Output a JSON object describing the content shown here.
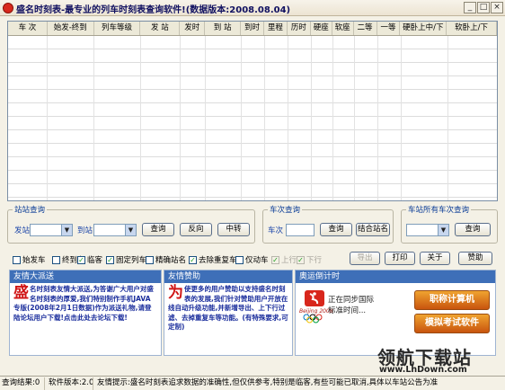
{
  "window": {
    "title": "盛名时刻表-最专业的列车时刻表查询软件!(数据版本:2008.08.04)",
    "min": "_",
    "max": "□",
    "close": "×"
  },
  "grid": {
    "columns": [
      "车 次",
      "始发-终到",
      "列车等级",
      "发 站",
      "发时",
      "到 站",
      "到时",
      "里程",
      "历时",
      "硬座",
      "软座",
      "二等",
      "一等",
      "硬卧上中/下",
      "软卧上/下"
    ]
  },
  "station_query": {
    "title": "站站查询",
    "from_label": "发站",
    "to_label": "到站",
    "query_btn": "查询",
    "reverse_btn": "反向",
    "transfer_btn": "中转"
  },
  "train_query": {
    "title": "车次查询",
    "train_label": "车次",
    "query_btn": "查询",
    "combo_btn": "结合站名"
  },
  "station_trains": {
    "title": "车站所有车次查询",
    "query_btn": "查询"
  },
  "checks": [
    {
      "label": "始发车",
      "checked": false,
      "disabled": false
    },
    {
      "label": "终到车",
      "checked": false,
      "disabled": false
    },
    {
      "label": "临客",
      "checked": true,
      "disabled": false
    },
    {
      "label": "固定列车",
      "checked": true,
      "disabled": false
    },
    {
      "label": "精确站名",
      "checked": false,
      "disabled": false
    },
    {
      "label": "去除重复车",
      "checked": true,
      "disabled": false
    },
    {
      "label": "仅动车",
      "checked": false,
      "disabled": false
    },
    {
      "label": "上行",
      "checked": true,
      "disabled": true
    },
    {
      "label": "下行",
      "checked": true,
      "disabled": true
    }
  ],
  "actions": {
    "export": "导出",
    "print": "打印",
    "about": "关于",
    "sponsor": "赞助"
  },
  "panels": {
    "friend_head": "友情大派送",
    "friend_big": "盛",
    "friend_text": "名时刻表友情大派送,为答谢广大用户对盛名时刻表的厚爱,我们特别制作手机JAVA专版(2008年2月1日数据)作为派送礼物,请登陆论坛用户下载!点击此处去论坛下载!",
    "sponsor_head": "友情赞助",
    "sponsor_big": "为",
    "sponsor_text": "使更多的用户赞助以支持盛名时刻表的发展,我们针对赞助用户开放在线自动升级功能,并新增导出、上下行过滤、去掉重复车等功能。(有特殊要求,可定制)",
    "olympic_head": "奥运倒计时",
    "olympic_line1": "正在同步国际",
    "olympic_line2": "标准时间...",
    "olympic_logo": "Beijing 2008",
    "promo1": "职称计算机",
    "promo2": "模拟考试软件"
  },
  "status": {
    "result": "查询结果:0",
    "version": "软件版本:2.05",
    "tip": "友情提示:盛名时刻表追求数据的准确性,但仅供参考,特别是临客,有些可能已取消,具体以车站公告为准"
  },
  "watermark": {
    "cn": "领航下载站",
    "url": "www.LhDown.com"
  },
  "colors": {
    "panel_bg": "#f4f1e6",
    "accent_blue": "#3e6fb8",
    "promo_red": "#c0392b"
  }
}
